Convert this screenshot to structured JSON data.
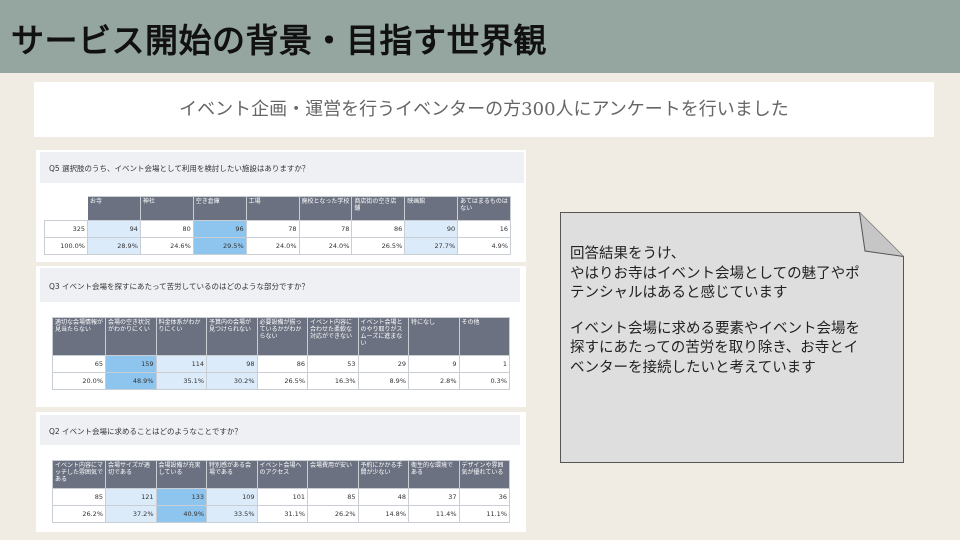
{
  "header": {
    "title": "サービス開始の背景・目指す世界観"
  },
  "subtitle": "イベント企画・運営を行うイベンターの方300人にアンケートを行いました",
  "surveys": [
    {
      "question": "Q5 選択肢のうち、イベント会場として利用を検討したい施設はありますか？",
      "columns": [
        "",
        "お寺",
        "神社",
        "空き倉庫",
        "工場",
        "廃校となった学校",
        "商店街の空き店舗",
        "映画館",
        "あてはまるものはない"
      ],
      "counts": [
        "325",
        "94",
        "80",
        "96",
        "78",
        "78",
        "86",
        "90",
        "16"
      ],
      "percents": [
        "100.0%",
        "28.9%",
        "24.6%",
        "29.5%",
        "24.0%",
        "24.0%",
        "26.5%",
        "27.7%",
        "4.9%"
      ],
      "highlights": [
        "",
        "hl",
        "",
        "hl2",
        "",
        "",
        "",
        "hl",
        ""
      ]
    },
    {
      "question": "Q3 イベント会場を探すにあたって苦労しているのはどのような部分ですか？",
      "columns": [
        "適切な会場情報が見当たらない",
        "会場の空き状況がわかりにくい",
        "料金体系がわかりにくい",
        "予算内の会場が見つけられない",
        "必要設備が揃っているかがわからない",
        "イベント内容に合わせた柔軟な対応ができない",
        "イベント会場とのやり取りがスムーズに進まない",
        "特になし",
        "その他"
      ],
      "counts": [
        "65",
        "159",
        "114",
        "98",
        "86",
        "53",
        "29",
        "9",
        "1"
      ],
      "percents": [
        "20.0%",
        "48.9%",
        "35.1%",
        "30.2%",
        "26.5%",
        "16.3%",
        "8.9%",
        "2.8%",
        "0.3%"
      ],
      "highlights": [
        "",
        "hl2",
        "hl",
        "hl",
        "",
        "",
        "",
        "",
        ""
      ]
    },
    {
      "question": "Q2 イベント会場に求めることはどのようなことですか？",
      "columns": [
        "イベント内容にマッチした雰囲気である",
        "会場サイズが適切である",
        "会場設備が充実している",
        "特別感がある会場である",
        "イベント会場へのアクセス",
        "会場費用が安い",
        "予約にかかる手間が少ない",
        "衛生的な環境である",
        "デザインや雰囲気が優れている"
      ],
      "counts": [
        "85",
        "121",
        "133",
        "109",
        "101",
        "85",
        "48",
        "37",
        "36"
      ],
      "percents": [
        "26.2%",
        "37.2%",
        "40.9%",
        "33.5%",
        "31.1%",
        "26.2%",
        "14.8%",
        "11.4%",
        "11.1%"
      ],
      "highlights": [
        "",
        "hl",
        "hl2",
        "hl",
        "",
        "",
        "",
        "",
        ""
      ]
    }
  ],
  "note": {
    "paragraphs": [
      "回答結果をうけ、\nやはりお寺はイベント会場としての魅了やポテンシャルはあると感じています",
      "イベント会場に求める要素やイベント会場を探すにあたっての苦労を取り除き、お寺とイベンターを接続したいと考えています"
    ]
  }
}
